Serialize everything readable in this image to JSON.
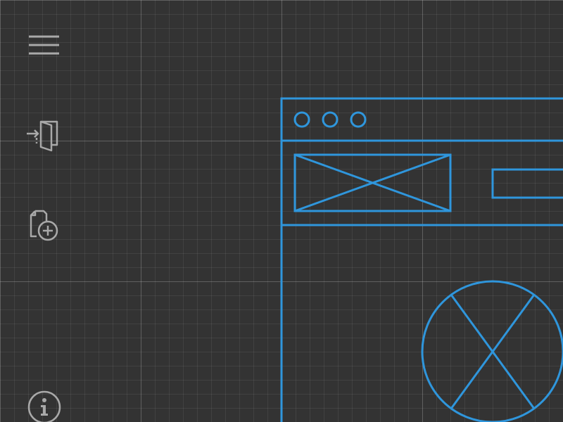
{
  "theme": {
    "background": "#333333",
    "grid_minor": "rgba(255,255,255,0.07)",
    "grid_major": "rgba(255,255,255,0.16)",
    "icon_color": "#a9a9a9",
    "wireframe_color": "#2f96dc"
  },
  "sidebar": {
    "icons": [
      {
        "name": "menu-icon"
      },
      {
        "name": "sign-in-icon"
      },
      {
        "name": "new-file-icon"
      },
      {
        "name": "info-icon"
      }
    ]
  },
  "wireframe": {
    "window_control_dots": 3,
    "placeholders": [
      "image-placeholder",
      "text-field-placeholder",
      "circle-image-placeholder"
    ]
  }
}
